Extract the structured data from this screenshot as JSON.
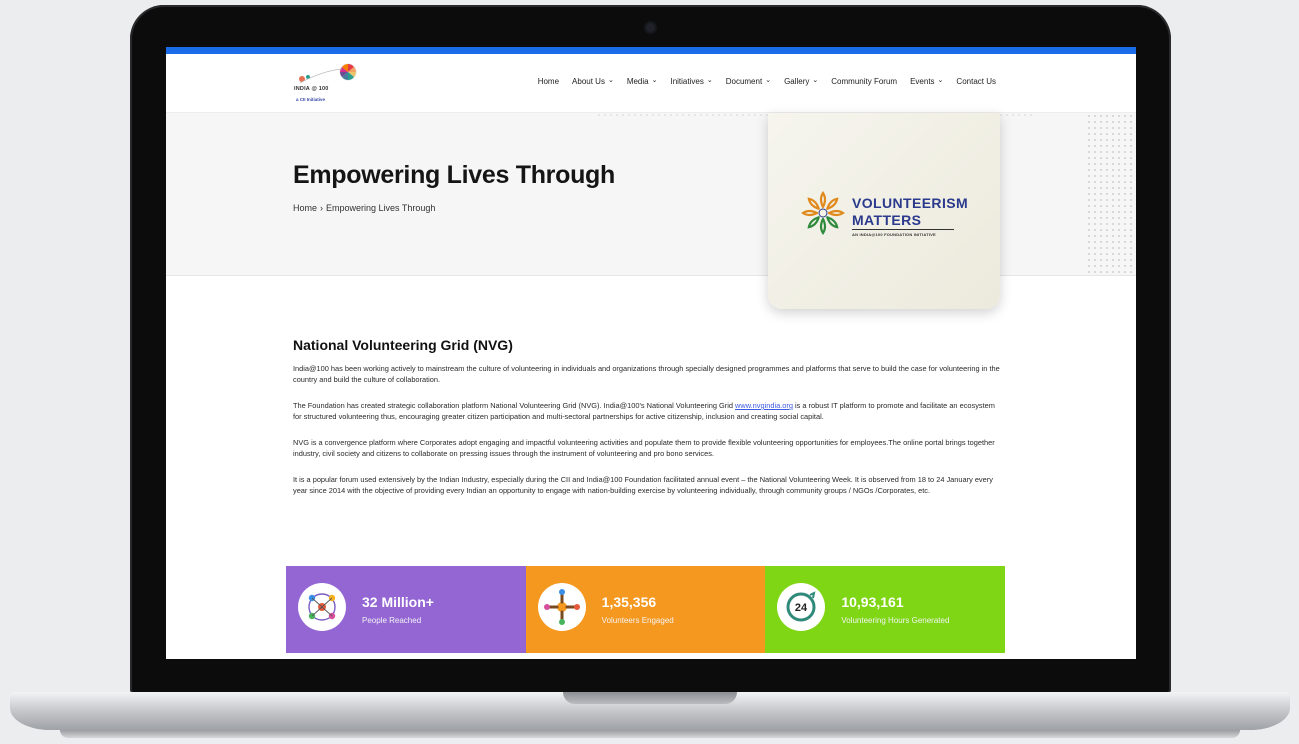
{
  "colors": {
    "accent_bar": "#1a6ce8",
    "stat_purple": "#9466d4",
    "stat_orange": "#f5981f",
    "stat_green": "#7ed614",
    "link": "#3d5be0",
    "vm_text": "#2b3a8c"
  },
  "logo": {
    "main": "INDIA @ 100",
    "sub": "a CII Initiative"
  },
  "nav": {
    "items": [
      {
        "label": "Home",
        "dropdown": false
      },
      {
        "label": "About Us",
        "dropdown": true
      },
      {
        "label": "Media",
        "dropdown": true
      },
      {
        "label": "Initiatives",
        "dropdown": true
      },
      {
        "label": "Document",
        "dropdown": true
      },
      {
        "label": "Gallery",
        "dropdown": true
      },
      {
        "label": "Community Forum",
        "dropdown": false
      },
      {
        "label": "Events",
        "dropdown": true
      },
      {
        "label": "Contact Us",
        "dropdown": false
      }
    ],
    "chevron_glyph": "⌄"
  },
  "hero": {
    "title": "Empowering Lives Through",
    "breadcrumb_home": "Home",
    "breadcrumb_sep": "›",
    "breadcrumb_current": "Empowering Lives Through"
  },
  "volunteerism_card": {
    "line1": "VOLUNTEERISM",
    "line2": "MATTERS",
    "tagline": "AN INDIA@100 FOUNDATION INITIATIVE"
  },
  "section": {
    "title": "National Volunteering Grid (NVG)",
    "para1": "India@100 has been working actively to mainstream the culture of volunteering in individuals and organizations through specially designed programmes and platforms that serve to build the case for volunteering in the country and build the culture of collaboration.",
    "para2_before": "The Foundation has created strategic collaboration platform National Volunteering Grid (NVG). India@100’s National Volunteering Grid ",
    "para2_link": "www.nvgindia.org",
    "para2_after": " is a robust IT platform to promote and facilitate an ecosystem for structured volunteering thus, encouraging greater citizen participation and multi-sectoral partnerships for active citizenship, inclusion and creating social capital.",
    "para3": "NVG is a convergence platform where Corporates adopt engaging and impactful volunteering activities and populate them to provide flexible volunteering opportunities for employees.The online portal brings together industry, civil society and citizens to collaborate on pressing issues through the instrument of volunteering and pro bono services.",
    "para4": "It is a popular forum used extensively by the Indian Industry, especially during the CII and India@100 Foundation facilitated annual event – the National Volunteering Week. It is observed from 18 to 24 January every year since 2014 with the objective of providing every Indian an opportunity to engage with nation-building exercise by volunteering individually, through community groups / NGOs /Corporates, etc."
  },
  "stats": [
    {
      "value": "32 Million+",
      "label": "People Reached",
      "icon": "people-network-icon",
      "color": "#9466d4"
    },
    {
      "value": "1,35,356",
      "label": "Volunteers Engaged",
      "icon": "volunteers-hands-icon",
      "color": "#f5981f"
    },
    {
      "value": "10,93,161",
      "label": "Volunteering Hours Generated",
      "icon": "24-hours-icon",
      "color": "#7ed614"
    }
  ]
}
